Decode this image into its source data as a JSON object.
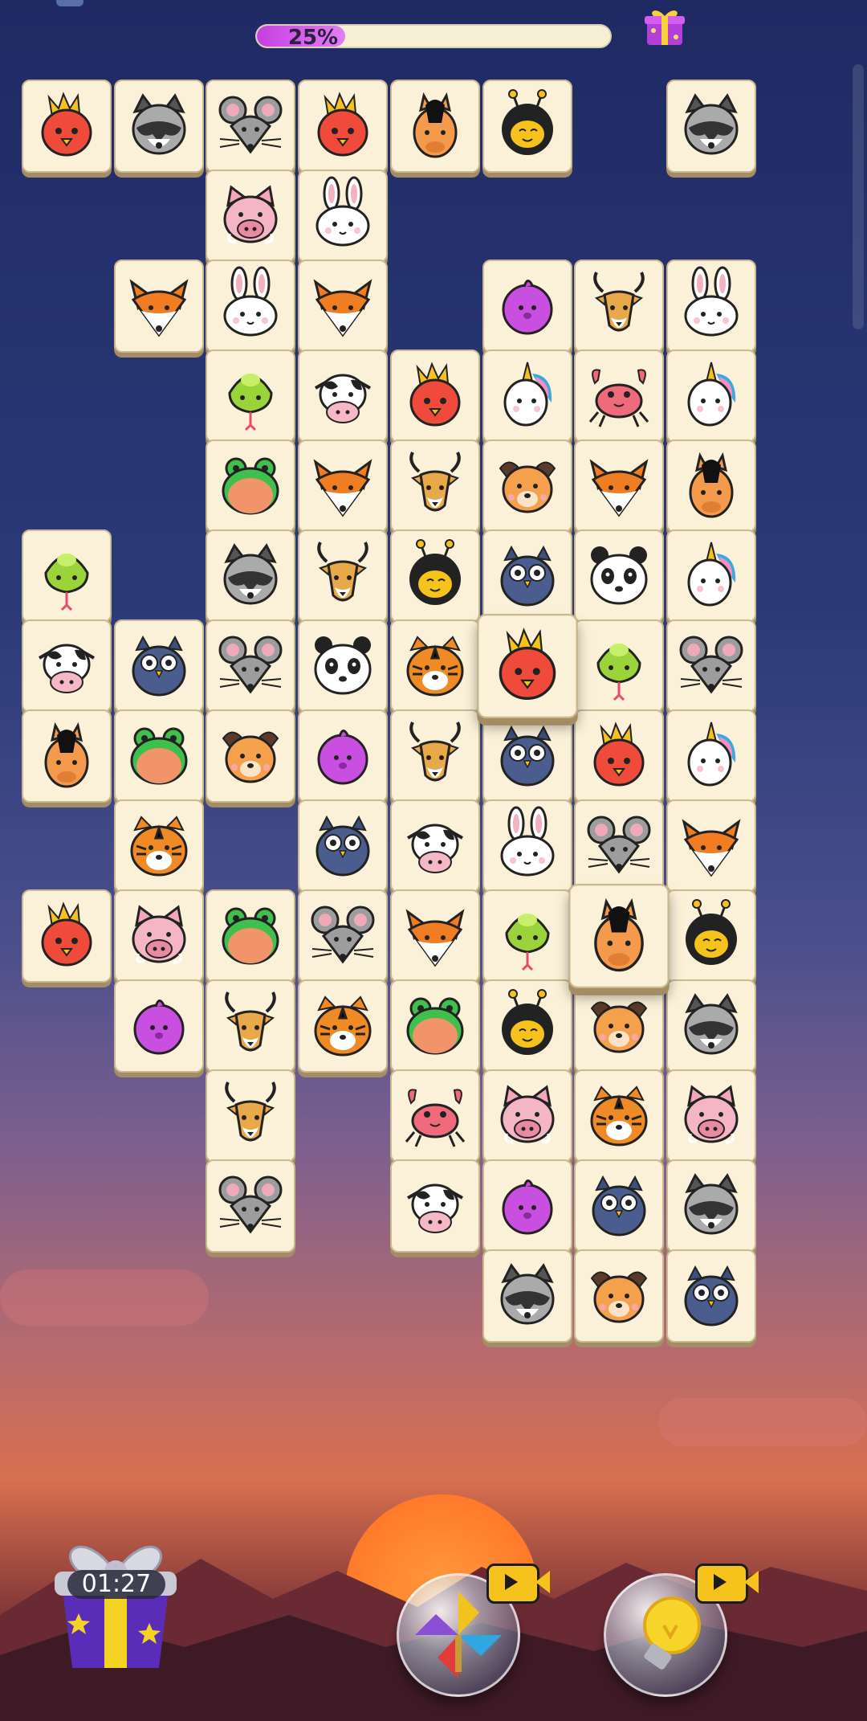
{
  "progress": {
    "percent_label": "25%",
    "fraction": 0.25
  },
  "timer": {
    "label": "01:27"
  },
  "boosters": [
    {
      "name": "shuffle",
      "icon": "pinwheel-icon",
      "has_video": true
    },
    {
      "name": "hint",
      "icon": "lightbulb-icon",
      "has_video": true
    }
  ],
  "colors": {
    "progress_fill": "#c73fe1",
    "tile_face": "#fbf1d8"
  },
  "tiles": [
    {
      "r": 0,
      "c": 0,
      "a": "rooster"
    },
    {
      "r": 0,
      "c": 1,
      "a": "raccoon"
    },
    {
      "r": 0,
      "c": 2,
      "a": "mouse"
    },
    {
      "r": 0,
      "c": 3,
      "a": "rooster"
    },
    {
      "r": 0,
      "c": 4,
      "a": "horse"
    },
    {
      "r": 0,
      "c": 5,
      "a": "bee"
    },
    {
      "r": 0,
      "c": 7,
      "a": "raccoon"
    },
    {
      "r": 1,
      "c": 2,
      "a": "pig"
    },
    {
      "r": 1,
      "c": 3,
      "a": "rabbit"
    },
    {
      "r": 2,
      "c": 1,
      "a": "fox"
    },
    {
      "r": 2,
      "c": 2,
      "a": "rabbit"
    },
    {
      "r": 2,
      "c": 3,
      "a": "fox"
    },
    {
      "r": 2,
      "c": 5,
      "a": "bird"
    },
    {
      "r": 2,
      "c": 6,
      "a": "deer"
    },
    {
      "r": 2,
      "c": 7,
      "a": "rabbit"
    },
    {
      "r": 3,
      "c": 2,
      "a": "snake"
    },
    {
      "r": 3,
      "c": 3,
      "a": "cow"
    },
    {
      "r": 3,
      "c": 4,
      "a": "rooster"
    },
    {
      "r": 3,
      "c": 5,
      "a": "unicorn"
    },
    {
      "r": 3,
      "c": 6,
      "a": "crab"
    },
    {
      "r": 3,
      "c": 7,
      "a": "unicorn"
    },
    {
      "r": 4,
      "c": 2,
      "a": "frog"
    },
    {
      "r": 4,
      "c": 3,
      "a": "fox"
    },
    {
      "r": 4,
      "c": 4,
      "a": "deer"
    },
    {
      "r": 4,
      "c": 5,
      "a": "dog"
    },
    {
      "r": 4,
      "c": 6,
      "a": "fox"
    },
    {
      "r": 4,
      "c": 7,
      "a": "horse"
    },
    {
      "r": 5,
      "c": 0,
      "a": "snake"
    },
    {
      "r": 5,
      "c": 2,
      "a": "raccoon"
    },
    {
      "r": 5,
      "c": 3,
      "a": "deer"
    },
    {
      "r": 5,
      "c": 4,
      "a": "bee"
    },
    {
      "r": 5,
      "c": 5,
      "a": "owl"
    },
    {
      "r": 5,
      "c": 6,
      "a": "panda"
    },
    {
      "r": 5,
      "c": 7,
      "a": "unicorn"
    },
    {
      "r": 6,
      "c": 0,
      "a": "cow"
    },
    {
      "r": 6,
      "c": 1,
      "a": "owl"
    },
    {
      "r": 6,
      "c": 2,
      "a": "mouse"
    },
    {
      "r": 6,
      "c": 3,
      "a": "panda"
    },
    {
      "r": 6,
      "c": 4,
      "a": "tiger"
    },
    {
      "r": 6,
      "c": 5,
      "a": "rooster",
      "raised": true
    },
    {
      "r": 6,
      "c": 6,
      "a": "snake"
    },
    {
      "r": 6,
      "c": 7,
      "a": "mouse"
    },
    {
      "r": 7,
      "c": 0,
      "a": "horse"
    },
    {
      "r": 7,
      "c": 1,
      "a": "frog"
    },
    {
      "r": 7,
      "c": 2,
      "a": "dog"
    },
    {
      "r": 7,
      "c": 3,
      "a": "bird"
    },
    {
      "r": 7,
      "c": 4,
      "a": "deer"
    },
    {
      "r": 7,
      "c": 5,
      "a": "owl"
    },
    {
      "r": 7,
      "c": 6,
      "a": "rooster"
    },
    {
      "r": 7,
      "c": 7,
      "a": "unicorn"
    },
    {
      "r": 8,
      "c": 1,
      "a": "tiger"
    },
    {
      "r": 8,
      "c": 3,
      "a": "owl"
    },
    {
      "r": 8,
      "c": 4,
      "a": "cow"
    },
    {
      "r": 8,
      "c": 5,
      "a": "rabbit"
    },
    {
      "r": 8,
      "c": 6,
      "a": "mouse"
    },
    {
      "r": 8,
      "c": 7,
      "a": "fox"
    },
    {
      "r": 9,
      "c": 0,
      "a": "rooster"
    },
    {
      "r": 9,
      "c": 1,
      "a": "pig"
    },
    {
      "r": 9,
      "c": 2,
      "a": "frog"
    },
    {
      "r": 9,
      "c": 3,
      "a": "mouse"
    },
    {
      "r": 9,
      "c": 4,
      "a": "fox"
    },
    {
      "r": 9,
      "c": 5,
      "a": "snake"
    },
    {
      "r": 9,
      "c": 6,
      "a": "horse",
      "raised": true
    },
    {
      "r": 9,
      "c": 7,
      "a": "bee"
    },
    {
      "r": 10,
      "c": 1,
      "a": "bird"
    },
    {
      "r": 10,
      "c": 2,
      "a": "deer"
    },
    {
      "r": 10,
      "c": 3,
      "a": "tiger"
    },
    {
      "r": 10,
      "c": 4,
      "a": "frog"
    },
    {
      "r": 10,
      "c": 5,
      "a": "bee"
    },
    {
      "r": 10,
      "c": 6,
      "a": "dog"
    },
    {
      "r": 10,
      "c": 7,
      "a": "raccoon"
    },
    {
      "r": 11,
      "c": 2,
      "a": "deer"
    },
    {
      "r": 11,
      "c": 4,
      "a": "crab"
    },
    {
      "r": 11,
      "c": 5,
      "a": "pig"
    },
    {
      "r": 11,
      "c": 6,
      "a": "tiger"
    },
    {
      "r": 11,
      "c": 7,
      "a": "pig"
    },
    {
      "r": 12,
      "c": 2,
      "a": "mouse"
    },
    {
      "r": 12,
      "c": 4,
      "a": "cow"
    },
    {
      "r": 12,
      "c": 5,
      "a": "bird"
    },
    {
      "r": 12,
      "c": 6,
      "a": "owl"
    },
    {
      "r": 12,
      "c": 7,
      "a": "raccoon"
    },
    {
      "r": 13,
      "c": 5,
      "a": "raccoon"
    },
    {
      "r": 13,
      "c": 6,
      "a": "dog"
    },
    {
      "r": 13,
      "c": 7,
      "a": "owl"
    }
  ]
}
